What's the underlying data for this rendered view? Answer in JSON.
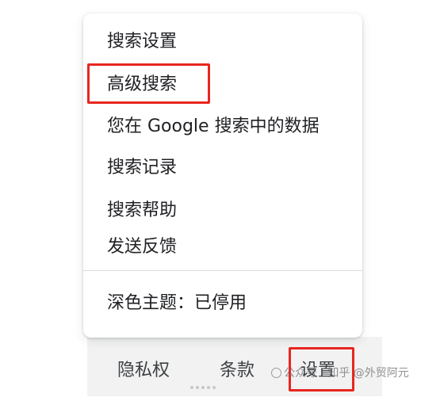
{
  "menu": {
    "items": [
      {
        "label": "搜索设置"
      },
      {
        "label": "高级搜索"
      },
      {
        "label": "您在 Google 搜索中的数据"
      },
      {
        "label": "搜索记录"
      },
      {
        "label": "搜索帮助"
      },
      {
        "label": "发送反馈"
      }
    ],
    "dark_theme": {
      "label": "深色主题：已停用"
    }
  },
  "footer": {
    "privacy": "隐私权",
    "terms": "条款",
    "settings": "设置"
  },
  "highlight_color": "#e8261f",
  "watermark": "公众号 · 知乎 @外贸阿元"
}
